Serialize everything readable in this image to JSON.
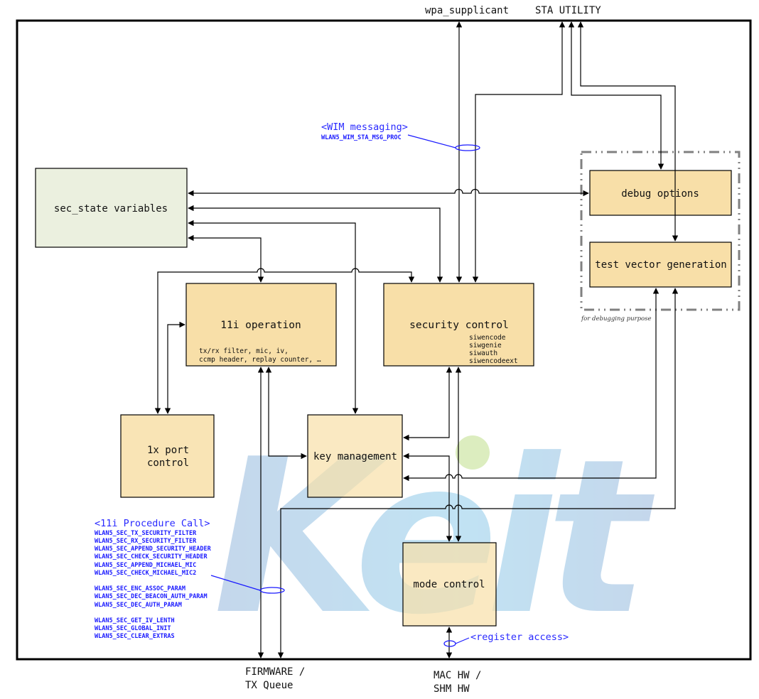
{
  "external": {
    "wpa_supplicant": "wpa_supplicant",
    "sta_utility": "STA UTILITY",
    "firmware_line1": "FIRMWARE /",
    "firmware_line2": "TX Queue",
    "machw_line1": "MAC HW /",
    "machw_line2": "SHM HW"
  },
  "blocks": {
    "sec_state": "sec_state variables",
    "debug_options": "debug options",
    "test_vector": "test vector generation",
    "debug_note": "for debugging purpose",
    "op_11i": {
      "title": "11i operation",
      "details": [
        "tx/rx filter, mic, iv,",
        "ccmp header, replay counter, …"
      ]
    },
    "security_control": {
      "title": "security control",
      "details": [
        "siwencode",
        "siwgenie",
        "siwauth",
        "siwencodeext"
      ]
    },
    "port_1x": [
      "1x port",
      "control"
    ],
    "key_management": "key management",
    "mode_control": "mode control"
  },
  "annotations": {
    "wim": {
      "title": "<WIM messaging>",
      "function": "WLAN5_WIM_STA_MSG_PROC"
    },
    "procedure_call": {
      "title": "<11i Procedure Call>",
      "groups": [
        [
          "WLAN5_SEC_TX_SECURITY_FILTER",
          "WLAN5_SEC_RX_SECURITY_FILTER",
          "WLAN5_SEC_APPEND_SECURITY_HEADER",
          "WLAN5_SEC_CHECK_SECURITY_HEADER",
          "WLAN5_SEC_APPEND_MICHAEL_MIC",
          "WLAN5_SEC_CHECK_MICHAEL_MIC2"
        ],
        [
          "WLAN5_SEC_ENC_ASSOC_PARAM",
          "WLAN5_SEC_DEC_BEACON_AUTH_PARAM",
          "WLAN5_SEC_DEC_AUTH_PARAM"
        ],
        [
          "WLAN5_SEC_GET_IV_LENTH",
          "WLAN5_SEC_GLOBAL_INIT",
          "WLAN5_SEC_CLEAR_EXTRAS"
        ]
      ]
    },
    "register_access": "<register access>"
  },
  "watermark": {
    "logo_text": "Keit",
    "pattern_text": "KEIT"
  },
  "colors": {
    "block_fill": "#f8dfa8",
    "sec_state_fill": "#ebf0df",
    "annotation": "#1a1aff",
    "debug_frame": "#808080"
  }
}
